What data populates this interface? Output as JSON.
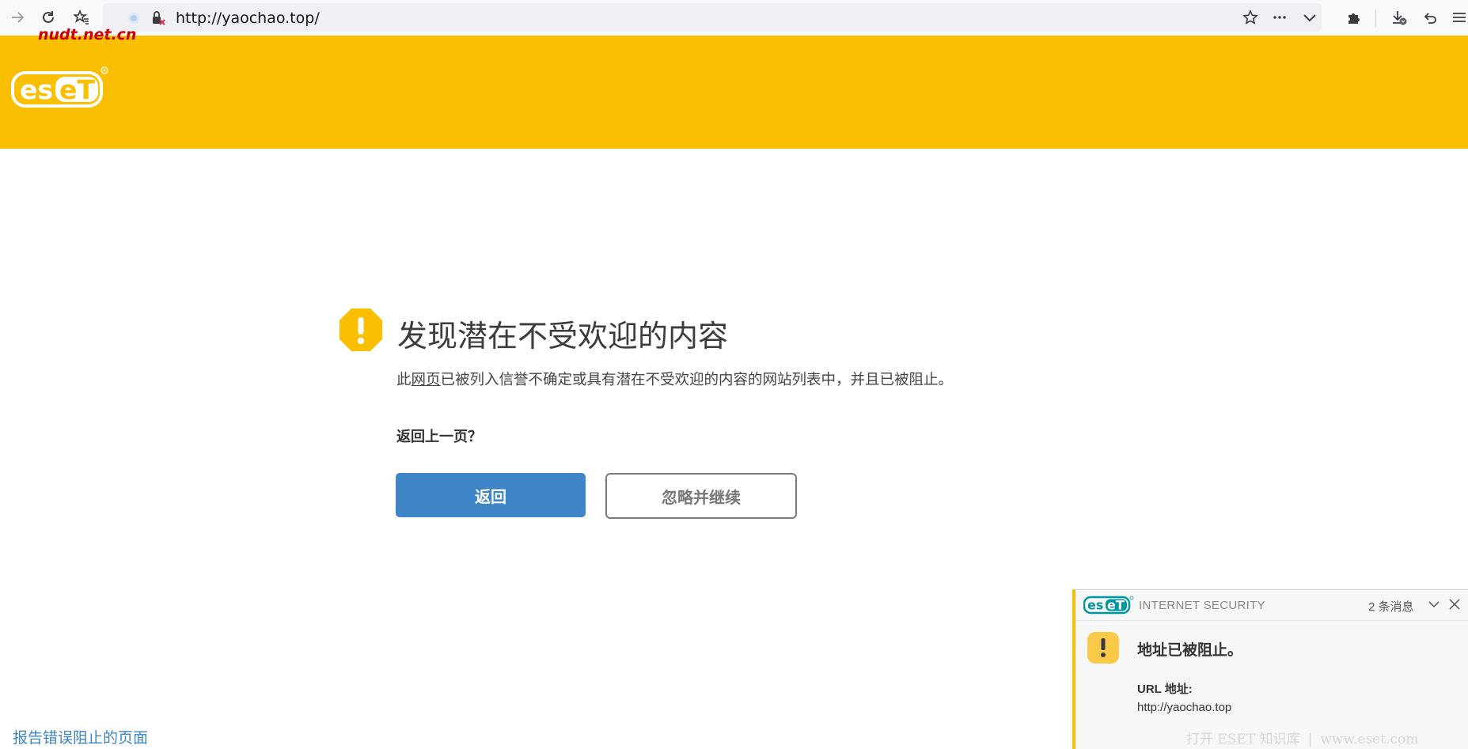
{
  "browser": {
    "url": "http://yaochao.top/",
    "watermark": "nudt.net.cn"
  },
  "page": {
    "title": "发现潜在不受欢迎的内容",
    "desc_prefix": "此",
    "desc_link": "网页",
    "desc_suffix": "已被列入信誉不确定或具有潜在不受欢迎的内容的网站列表中，并且已被阻止。",
    "goback_question": "返回上一页？",
    "back_button": "返回",
    "ignore_button": "忽略并继续",
    "report_link": "报告错误阻止的页面"
  },
  "notification": {
    "logo_text": "eset",
    "product": "INTERNET SECURITY",
    "count": "2 条消息",
    "title": "地址已被阻止。",
    "url_label": "URL 地址:",
    "url_value": "http://yaochao.top",
    "footer_kb": "打开 ESET 知识库",
    "footer_sep": "|",
    "footer_site": "www.eset.com"
  },
  "colors": {
    "brand_yellow": "#f9bf00",
    "button_blue": "#3d85c6",
    "eset_teal": "#0096a1"
  }
}
